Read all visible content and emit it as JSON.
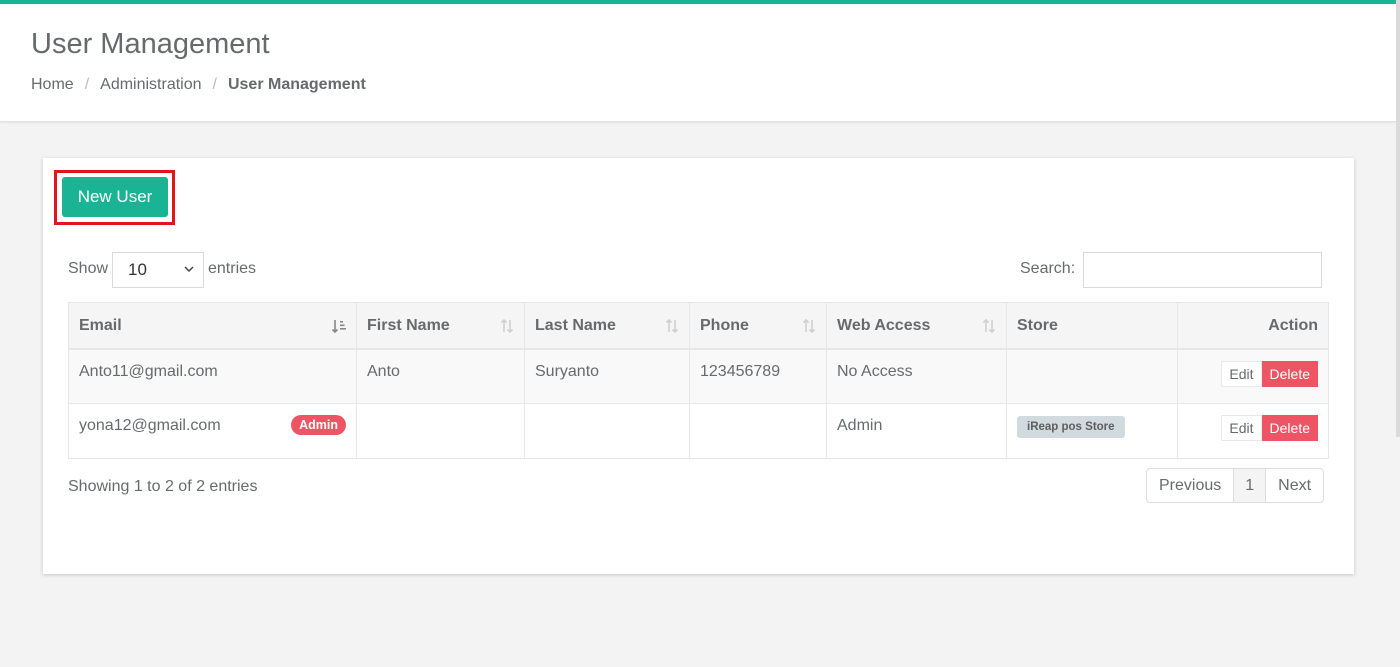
{
  "header": {
    "title": "User Management",
    "breadcrumb": [
      "Home",
      "Administration",
      "User Management"
    ],
    "accent_color": "#1ab394"
  },
  "toolbar": {
    "new_user_label": "New User"
  },
  "length_menu": {
    "show_label": "Show",
    "value": "10",
    "entries_label": "entries"
  },
  "search": {
    "label": "Search:",
    "value": ""
  },
  "table": {
    "columns": [
      "Email",
      "First Name",
      "Last Name",
      "Phone",
      "Web Access",
      "Store",
      "Action"
    ],
    "rows": [
      {
        "email": "Anto11@gmail.com",
        "first_name": "Anto",
        "last_name": "Suryanto",
        "phone": "123456789",
        "web_access": "No Access",
        "store": "",
        "badge": "",
        "edit_label": "Edit",
        "delete_label": "Delete"
      },
      {
        "email": "yona12@gmail.com",
        "first_name": "",
        "last_name": "",
        "phone": "",
        "web_access": "Admin",
        "store": "iReap pos Store",
        "badge": "Admin",
        "edit_label": "Edit",
        "delete_label": "Delete"
      }
    ]
  },
  "info": "Showing 1 to 2 of 2 entries",
  "pagination": {
    "previous": "Previous",
    "current": "1",
    "next": "Next"
  },
  "colors": {
    "primary": "#1ab394",
    "danger": "#ed5565",
    "highlight_border": "#e2141c"
  },
  "icons": [
    "sort-ascending-icon",
    "sort-icon",
    "chevron-down-icon"
  ]
}
